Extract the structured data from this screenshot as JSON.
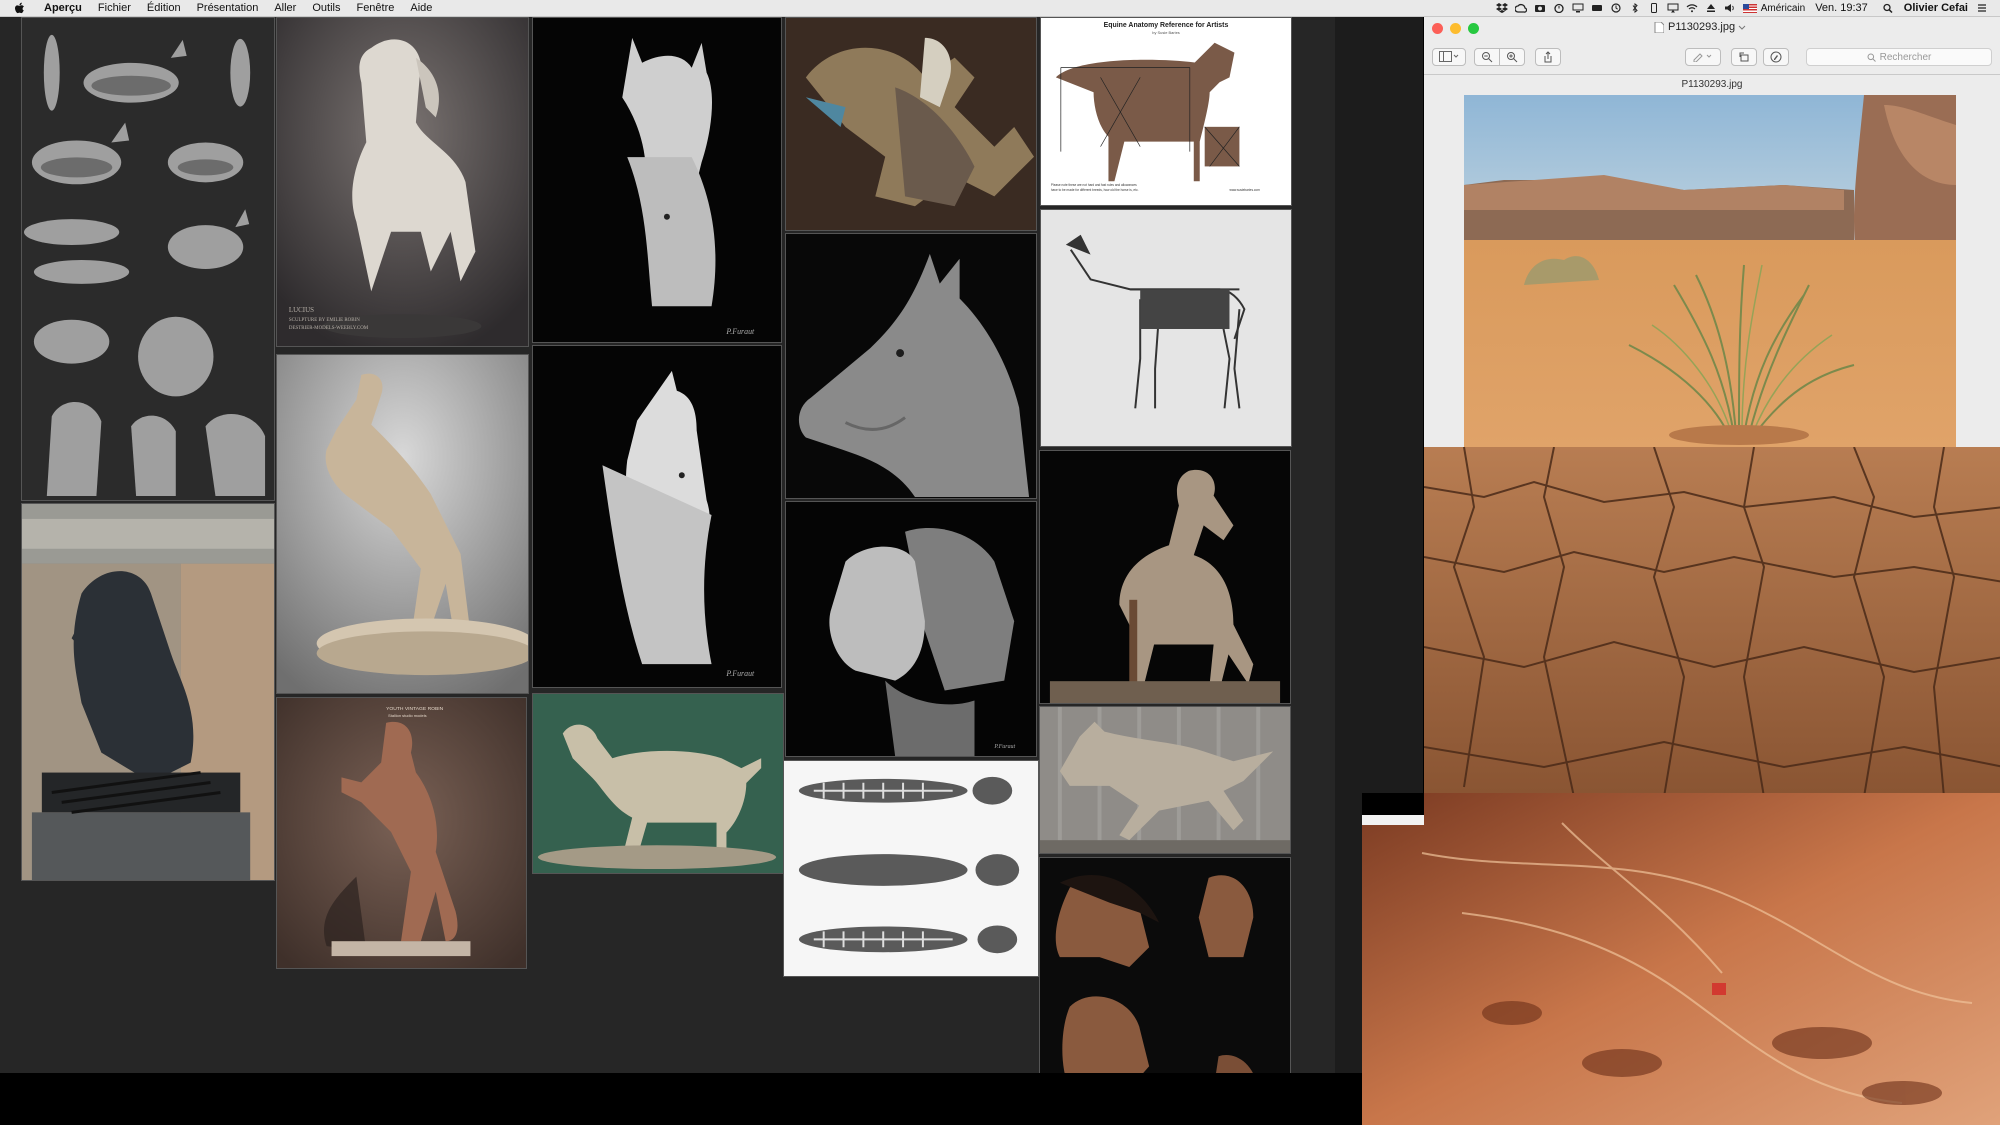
{
  "menubar": {
    "app_name": "Aperçu",
    "menus": [
      "Fichier",
      "Édition",
      "Présentation",
      "Aller",
      "Outils",
      "Fenêtre",
      "Aide"
    ],
    "status": {
      "input_source": "Américain",
      "clock": "Ven. 19:37",
      "user": "Olivier Cefai"
    }
  },
  "preview_window": {
    "title": "P1130293.jpg",
    "search_placeholder": "Rechercher",
    "filename_label": "P1130293.jpg"
  },
  "canvas": {
    "tile_captions": {
      "lucius_line1": "LUCIUS",
      "lucius_line2": "SCULPTURE BY EMILIE ROBIN",
      "lucius_line3": "DESTRIER-MODELS-WEEBLY.COM",
      "furaut_1": "P.Furaut",
      "furaut_2": "P.Furaut",
      "furaut_3": "P.Furaut",
      "anatomy_title": "Equine Anatomy Reference for Artists",
      "anatomy_byline": "by Susie Baries",
      "anatomy_footnote_1": "Please note these are not hard and fast rules and allowances",
      "anatomy_footnote_2": "have to be made for different breeds, how old the horse is, etc.",
      "anatomy_site": "www.susiebaries.com",
      "rearing_caption": "YOUTH VINTAGE ROBIN",
      "rearing_sub": "Stallion studio models"
    }
  },
  "colors": {
    "menubar_bg": "#e9e9e9",
    "canvas_bg": "#262626",
    "window_bg": "#ececec",
    "close": "#fc5f57",
    "minimize": "#fdbc2e",
    "zoom": "#27c840"
  }
}
